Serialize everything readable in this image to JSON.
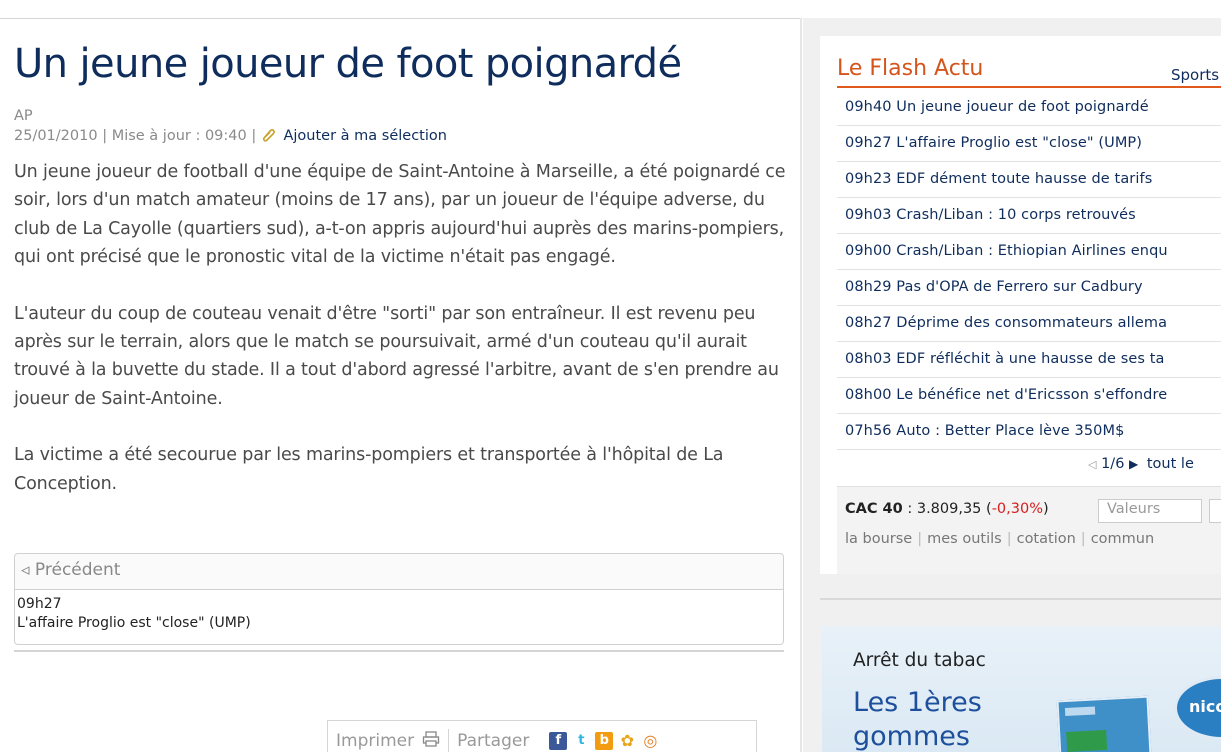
{
  "article": {
    "title": "Un jeune joueur de foot poignardé",
    "source": "AP",
    "date": "25/01/2010",
    "updated": "Mise à jour : 09:40",
    "add_selection": "Ajouter à ma sélection",
    "paragraphs": [
      "Un jeune joueur de football d'une équipe de Saint-Antoine à Marseille, a été poignardé ce soir, lors d'un match amateur (moins de 17 ans), par un joueur de l'équipe adverse, du club de La Cayolle (quartiers sud), a-t-on appris aujourd'hui auprès des marins-pompiers, qui ont précisé que le pronostic vital de la victime n'était pas engagé.",
      "L'auteur du coup de couteau venait d'être \"sorti\" par son entraîneur. Il est revenu peu après sur le terrain, alors que le match se poursuivait, armé d'un couteau qu'il aurait trouvé à la buvette du stade. Il a tout d'abord agressé l'arbitre, avant de s'en prendre au joueur de Saint-Antoine.",
      "La victime a été secourue par les marins-pompiers et transportée à l'hôpital de La Conception."
    ]
  },
  "previous": {
    "label": "◃ Précédent",
    "time": "09h27",
    "title": "L'affaire Proglio est \"close\" (UMP)"
  },
  "share": {
    "print_label": "Imprimer",
    "share_label": "Partager"
  },
  "flash": {
    "title": "Le Flash Actu",
    "tab": "Sports",
    "items": [
      "09h40 Un jeune joueur de foot poignardé",
      "09h27 L'affaire Proglio est \"close\" (UMP)",
      "09h23 EDF dément toute hausse de tarifs",
      "09h03 Crash/Liban : 10 corps retrouvés",
      "09h00 Crash/Liban : Ethiopian Airlines enqu",
      "08h29 Pas d'OPA de Ferrero sur Cadbury",
      "08h27 Déprime des consommateurs allema",
      "08h03 EDF réfléchit à une hausse de ses ta",
      "08h00 Le bénéfice net d'Ericsson s'effondre",
      "07h56 Auto : Better Place lève 350M$"
    ],
    "pager": "1/6",
    "see_all": "tout le"
  },
  "market": {
    "index": "CAC 40",
    "value": " : 3.809,35 (",
    "change": "-0,30%",
    "close": ")",
    "search_placeholder": "Valeurs",
    "links": [
      "la bourse",
      "mes outils",
      "cotation",
      "commun"
    ]
  },
  "ad": {
    "heading": "Arrêt du tabac",
    "line1": "Les 1ères",
    "line2": "gommes",
    "brand": "nico"
  },
  "colors": {
    "headline": "#0f2d5c",
    "flash_accent": "#d4541c",
    "negative": "#d42020"
  }
}
